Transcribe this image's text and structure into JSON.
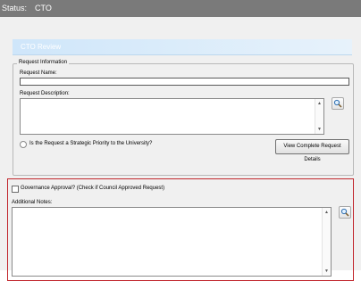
{
  "status": {
    "label": "Status:",
    "value": "CTO"
  },
  "section": {
    "title": "CTO Review"
  },
  "request_info": {
    "group_label": "Request Information",
    "name_label": "Request Name:",
    "name_value": "",
    "description_label": "Request Description:",
    "description_value": "",
    "strategic_label": "Is the Request a Strategic Priority to the University?",
    "strategic_checked": false,
    "view_details_label": "View Complete Request Details"
  },
  "governance": {
    "approval_label": "Governance Approval? (Check if Council Approved Request)",
    "approval_checked": false,
    "notes_label": "Additional Notes:",
    "notes_value": ""
  },
  "colors": {
    "status_bar": "#7a7a7a",
    "header_band": "#cfe6fa",
    "highlight_border": "#c1272d"
  }
}
